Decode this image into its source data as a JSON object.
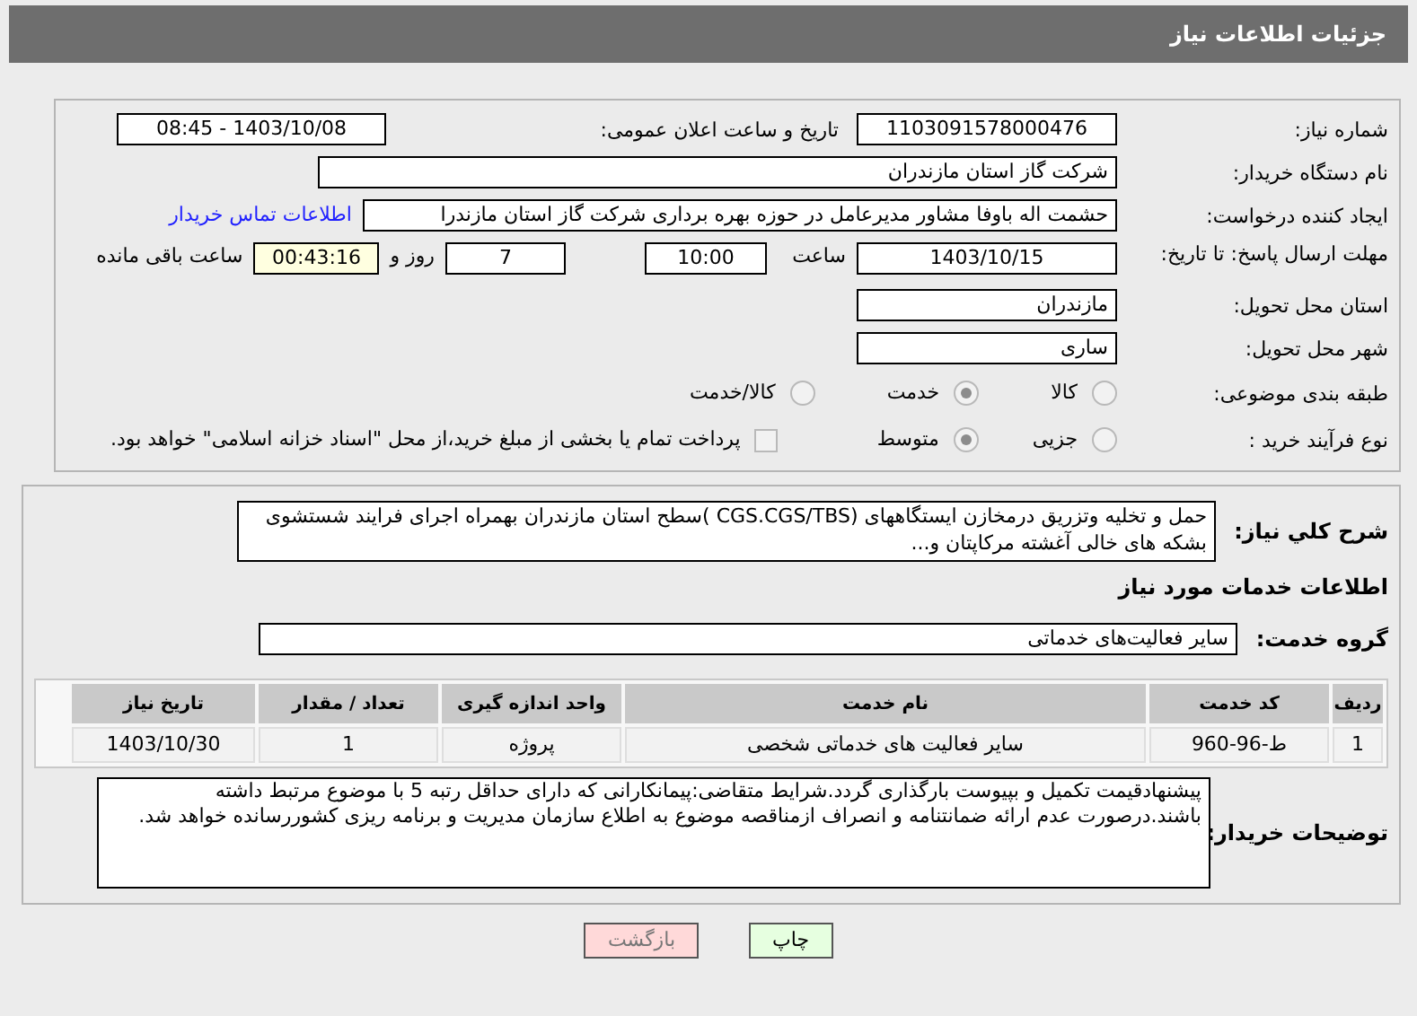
{
  "header": {
    "title": "جزئیات اطلاعات نیاز"
  },
  "need_number": {
    "label": "شماره نیاز:",
    "value": "1103091578000476"
  },
  "announce": {
    "label": "تاریخ و ساعت اعلان عمومی:",
    "value": "1403/10/08 - 08:45"
  },
  "buyer": {
    "label": "نام دستگاه خریدار:",
    "value": "شرکت گاز استان مازندران"
  },
  "requester": {
    "label": "ایجاد کننده درخواست:",
    "value": "حشمت اله باوفا مشاور مدیرعامل در حوزه بهره برداری  شرکت گاز استان مازندرا",
    "link": "اطلاعات تماس خریدار"
  },
  "deadline": {
    "label": "مهلت ارسال پاسخ: تا تاریخ:",
    "date": "1403/10/15",
    "time_label": "ساعت",
    "time": "10:00",
    "days": "7",
    "days_label": "روز و",
    "remaining": "00:43:16",
    "remaining_label": "ساعت باقی مانده"
  },
  "province": {
    "label": "استان محل تحویل:",
    "value": "مازندران"
  },
  "city": {
    "label": "شهر محل تحویل:",
    "value": "ساری"
  },
  "category": {
    "label": "طبقه بندی موضوعی:",
    "options": [
      {
        "label": "کالا",
        "selected": false
      },
      {
        "label": "خدمت",
        "selected": true
      },
      {
        "label": "کالا/خدمت",
        "selected": false
      }
    ]
  },
  "process": {
    "label": "نوع فرآیند خرید :",
    "options": [
      {
        "label": "جزیی",
        "selected": false
      },
      {
        "label": "متوسط",
        "selected": true
      }
    ],
    "payment": {
      "label": "پرداخت تمام یا بخشی از مبلغ خرید،از محل \"اسناد خزانه اسلامی\" خواهد بود.",
      "checked": false
    }
  },
  "description": {
    "label": "شرح کلي نياز:",
    "value": "حمل و تخلیه وتزریق درمخازن ایستگاههای (CGS.CGS/TBS )سطح استان مازندران بهمراه اجرای فرایند شستشوی بشکه های خالی آغشته مرکاپتان و..."
  },
  "services_heading": "اطلاعات خدمات مورد نیاز",
  "service_group": {
    "label": "گروه خدمت:",
    "value": "سایر فعالیت‌های خدماتی"
  },
  "table": {
    "columns": [
      "ردیف",
      "کد خدمت",
      "نام خدمت",
      "واحد اندازه گیری",
      "تعداد / مقدار",
      "تاریخ نیاز"
    ],
    "rows": [
      [
        "1",
        "ط-96-960",
        "سایر فعالیت های خدماتی شخصی",
        "پروژه",
        "1",
        "1403/10/30"
      ]
    ]
  },
  "notes": {
    "label": "توضیحات خریدار:",
    "value": "پیشنهادقیمت تکمیل و بپیوست بارگذاری گردد.شرایط متقاضی:پیمانکارانی که دارای حداقل رتبه 5 با موضوع مرتبط داشته باشند.درصورت عدم ارائه ضمانتنامه و انصراف ازمناقصه موضوع به اطلاع سازمان مدیریت و برنامه ریزی کشوررسانده خواهد شد."
  },
  "buttons": [
    {
      "label": "چاپ",
      "kind": "print"
    },
    {
      "label": "بازگشت",
      "kind": "back"
    }
  ]
}
